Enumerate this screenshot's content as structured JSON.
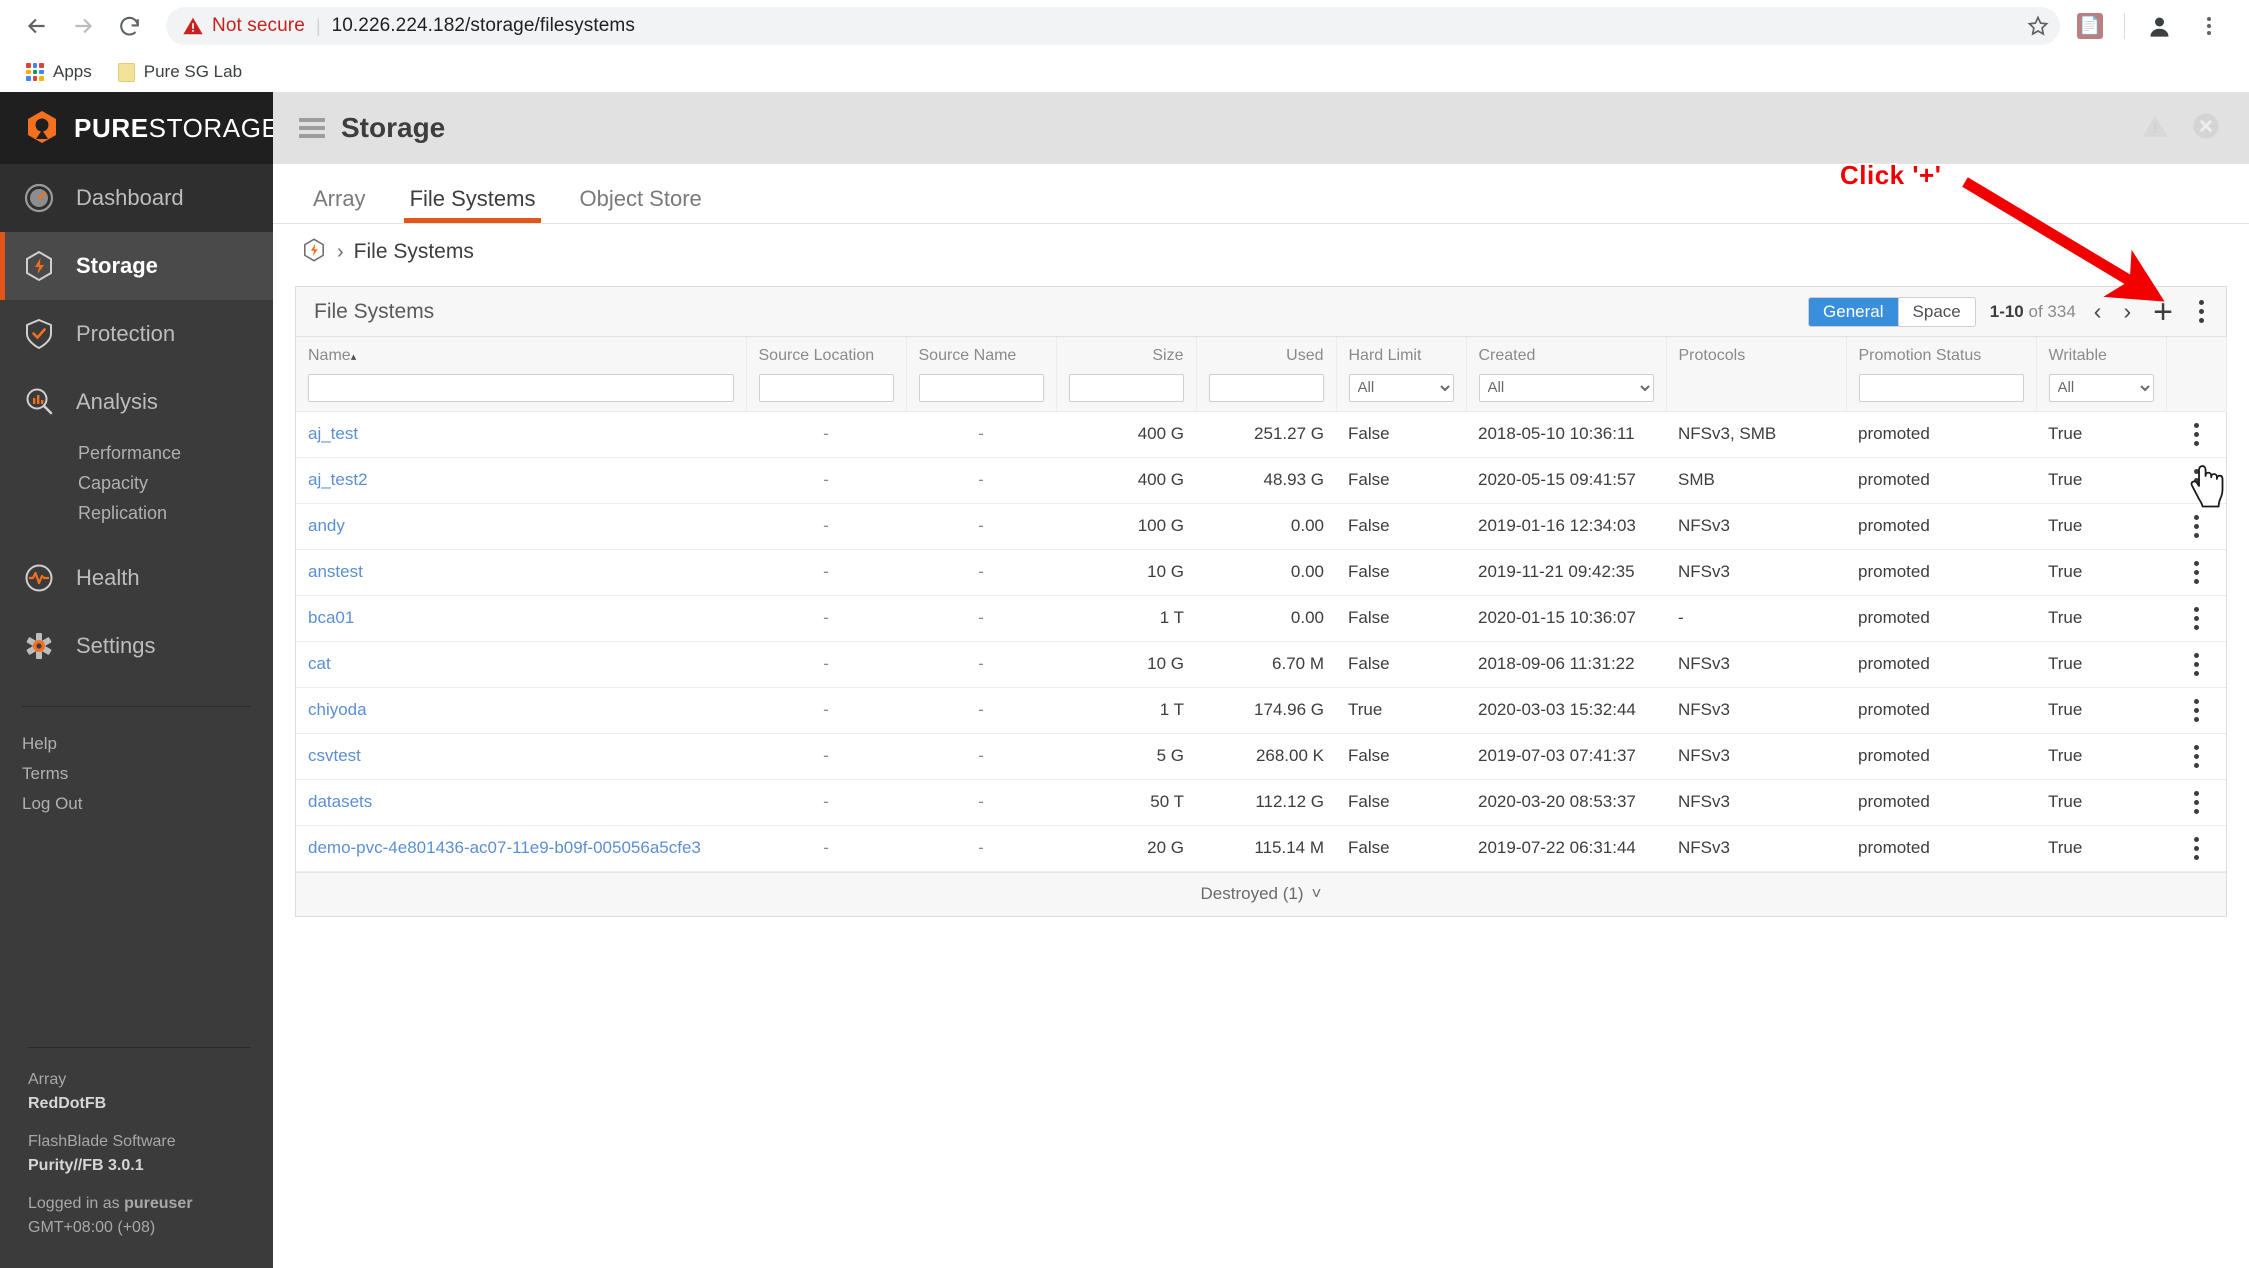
{
  "browser": {
    "back_icon": "back-arrow-icon",
    "forward_icon": "forward-arrow-icon",
    "reload_icon": "reload-icon",
    "security_label": "Not secure",
    "url": "10.226.224.182/storage/filesystems",
    "star_icon": "bookmark-star-icon",
    "extension_icon": "adobe-pdf-extension-icon",
    "profile_icon": "profile-avatar-icon",
    "menu_icon": "browser-menu-icon",
    "bookmarks": [
      {
        "label": "Apps",
        "icon": "apps-grid-icon"
      },
      {
        "label": "Pure SG Lab",
        "icon": "folder-icon"
      }
    ]
  },
  "sidebar": {
    "logo": {
      "brand_bold": "PURE",
      "brand_light": "STORAGE",
      "trademark": "®"
    },
    "items": [
      {
        "label": "Dashboard",
        "icon": "gauge-icon"
      },
      {
        "label": "Storage",
        "icon": "storage-hex-icon"
      },
      {
        "label": "Protection",
        "icon": "shield-check-icon"
      },
      {
        "label": "Analysis",
        "icon": "analysis-magnifier-icon"
      },
      {
        "label": "Health",
        "icon": "heartbeat-icon"
      },
      {
        "label": "Settings",
        "icon": "gear-icon"
      }
    ],
    "analysis_sub": [
      "Performance",
      "Capacity",
      "Replication"
    ],
    "links": [
      "Help",
      "Terms",
      "Log Out"
    ],
    "footer": {
      "array_label": "Array",
      "array_name": "RedDotFB",
      "software_label": "FlashBlade Software",
      "software_version": "Purity//FB 3.0.1",
      "logged_in_prefix": "Logged in as ",
      "logged_in_user": "pureuser",
      "timezone": "GMT+08:00 (+08)"
    }
  },
  "header": {
    "menu_icon": "hamburger-icon",
    "title": "Storage",
    "alert_icon": "warning-triangle-icon",
    "close_icon": "close-circle-icon"
  },
  "tabs": [
    {
      "label": "Array",
      "active": false
    },
    {
      "label": "File Systems",
      "active": true
    },
    {
      "label": "Object Store",
      "active": false
    }
  ],
  "breadcrumb": {
    "icon": "storage-hex-icon",
    "separator": "›",
    "current": "File Systems"
  },
  "card": {
    "title": "File Systems",
    "view_toggle": {
      "options": [
        "General",
        "Space"
      ],
      "selected": "General"
    },
    "pagination": {
      "range": "1-10",
      "of_label": "of",
      "total": "334",
      "prev_icon": "chevron-left-icon",
      "next_icon": "chevron-right-icon"
    },
    "add_label": "+",
    "menu_icon": "kebab-menu-icon",
    "footer": {
      "label": "Destroyed (1)",
      "chevron": "˅"
    }
  },
  "table": {
    "columns": [
      {
        "key": "name",
        "label": "Name",
        "sorted": true,
        "sort_caret": "▴",
        "align": "left",
        "filter": {
          "type": "text",
          "value": ""
        }
      },
      {
        "key": "source_location",
        "label": "Source Location",
        "align": "left",
        "filter": {
          "type": "text",
          "value": ""
        }
      },
      {
        "key": "source_name",
        "label": "Source Name",
        "align": "left",
        "filter": {
          "type": "text",
          "value": ""
        }
      },
      {
        "key": "size",
        "label": "Size",
        "align": "right",
        "filter": {
          "type": "text",
          "value": ""
        }
      },
      {
        "key": "used",
        "label": "Used",
        "align": "right",
        "filter": {
          "type": "text",
          "value": ""
        }
      },
      {
        "key": "hard_limit",
        "label": "Hard Limit",
        "align": "left",
        "filter": {
          "type": "select",
          "value": "All"
        }
      },
      {
        "key": "created",
        "label": "Created",
        "align": "left",
        "filter": {
          "type": "select",
          "value": "All"
        }
      },
      {
        "key": "protocols",
        "label": "Protocols",
        "align": "left",
        "filter": {
          "type": "none"
        }
      },
      {
        "key": "promotion_status",
        "label": "Promotion Status",
        "align": "left",
        "filter": {
          "type": "text",
          "value": ""
        }
      },
      {
        "key": "writable",
        "label": "Writable",
        "align": "left",
        "filter": {
          "type": "select",
          "value": "All"
        }
      }
    ],
    "rows": [
      {
        "name": "aj_test",
        "source_location": "-",
        "source_name": "-",
        "size": "400 G",
        "used": "251.27 G",
        "hard_limit": "False",
        "created": "2018-05-10 10:36:11",
        "protocols": "NFSv3, SMB",
        "promotion_status": "promoted",
        "writable": "True"
      },
      {
        "name": "aj_test2",
        "source_location": "-",
        "source_name": "-",
        "size": "400 G",
        "used": "48.93 G",
        "hard_limit": "False",
        "created": "2020-05-15 09:41:57",
        "protocols": "SMB",
        "promotion_status": "promoted",
        "writable": "True"
      },
      {
        "name": "andy",
        "source_location": "-",
        "source_name": "-",
        "size": "100 G",
        "used": "0.00",
        "hard_limit": "False",
        "created": "2019-01-16 12:34:03",
        "protocols": "NFSv3",
        "promotion_status": "promoted",
        "writable": "True"
      },
      {
        "name": "anstest",
        "source_location": "-",
        "source_name": "-",
        "size": "10 G",
        "used": "0.00",
        "hard_limit": "False",
        "created": "2019-11-21 09:42:35",
        "protocols": "NFSv3",
        "promotion_status": "promoted",
        "writable": "True"
      },
      {
        "name": "bca01",
        "source_location": "-",
        "source_name": "-",
        "size": "1 T",
        "used": "0.00",
        "hard_limit": "False",
        "created": "2020-01-15 10:36:07",
        "protocols": "-",
        "promotion_status": "promoted",
        "writable": "True"
      },
      {
        "name": "cat",
        "source_location": "-",
        "source_name": "-",
        "size": "10 G",
        "used": "6.70 M",
        "hard_limit": "False",
        "created": "2018-09-06 11:31:22",
        "protocols": "NFSv3",
        "promotion_status": "promoted",
        "writable": "True"
      },
      {
        "name": "chiyoda",
        "source_location": "-",
        "source_name": "-",
        "size": "1 T",
        "used": "174.96 G",
        "hard_limit": "True",
        "created": "2020-03-03 15:32:44",
        "protocols": "NFSv3",
        "promotion_status": "promoted",
        "writable": "True"
      },
      {
        "name": "csvtest",
        "source_location": "-",
        "source_name": "-",
        "size": "5 G",
        "used": "268.00 K",
        "hard_limit": "False",
        "created": "2019-07-03 07:41:37",
        "protocols": "NFSv3",
        "promotion_status": "promoted",
        "writable": "True"
      },
      {
        "name": "datasets",
        "source_location": "-",
        "source_name": "-",
        "size": "50 T",
        "used": "112.12 G",
        "hard_limit": "False",
        "created": "2020-03-20 08:53:37",
        "protocols": "NFSv3",
        "promotion_status": "promoted",
        "writable": "True"
      },
      {
        "name": "demo-pvc-4e801436-ac07-11e9-b09f-005056a5cfe3",
        "source_location": "-",
        "source_name": "-",
        "size": "20 G",
        "used": "115.14 M",
        "hard_limit": "False",
        "created": "2019-07-22 06:31:44",
        "protocols": "NFSv3",
        "promotion_status": "promoted",
        "writable": "True"
      }
    ]
  },
  "annotation": {
    "text": "Click '+'",
    "color": "#f20000",
    "arrow": "annotation-arrow-icon"
  },
  "colors": {
    "brand_orange": "#e3561a",
    "accent_blue": "#3a8fdc",
    "link_blue": "#5b8fd4",
    "sidebar_bg": "#3b3b3b",
    "annotation_red": "#f20000"
  }
}
